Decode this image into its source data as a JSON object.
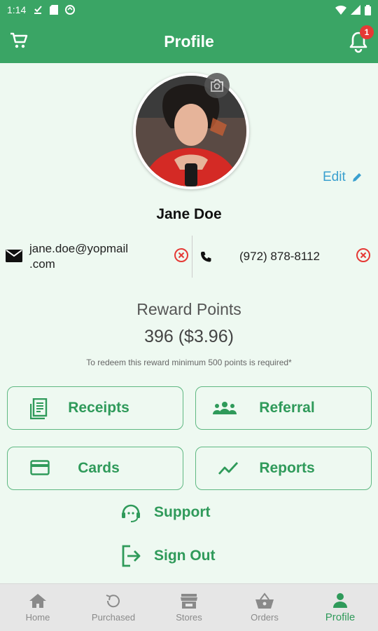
{
  "status_bar": {
    "time": "1:14"
  },
  "header": {
    "title": "Profile",
    "notification_count": "1"
  },
  "profile": {
    "edit_label": "Edit",
    "name": "Jane Doe",
    "email_line1": "jane.doe@yopmail",
    "email_line2": ".com",
    "phone": "(972) 878-8112"
  },
  "rewards": {
    "label": "Reward Points",
    "value": "396 ($3.96)",
    "note": "To redeem this reward minimum 500 points is required*"
  },
  "actions": {
    "receipts": "Receipts",
    "referral": "Referral",
    "cards": "Cards",
    "reports": "Reports",
    "support": "Support",
    "sign_out": "Sign Out"
  },
  "nav": {
    "home": "Home",
    "purchased": "Purchased",
    "stores": "Stores",
    "orders": "Orders",
    "profile": "Profile"
  },
  "colors": {
    "primary": "#3aa565",
    "accent_text": "#2f9a5a",
    "link": "#3aa0cf",
    "danger": "#e53935",
    "background": "#eef9f1"
  }
}
